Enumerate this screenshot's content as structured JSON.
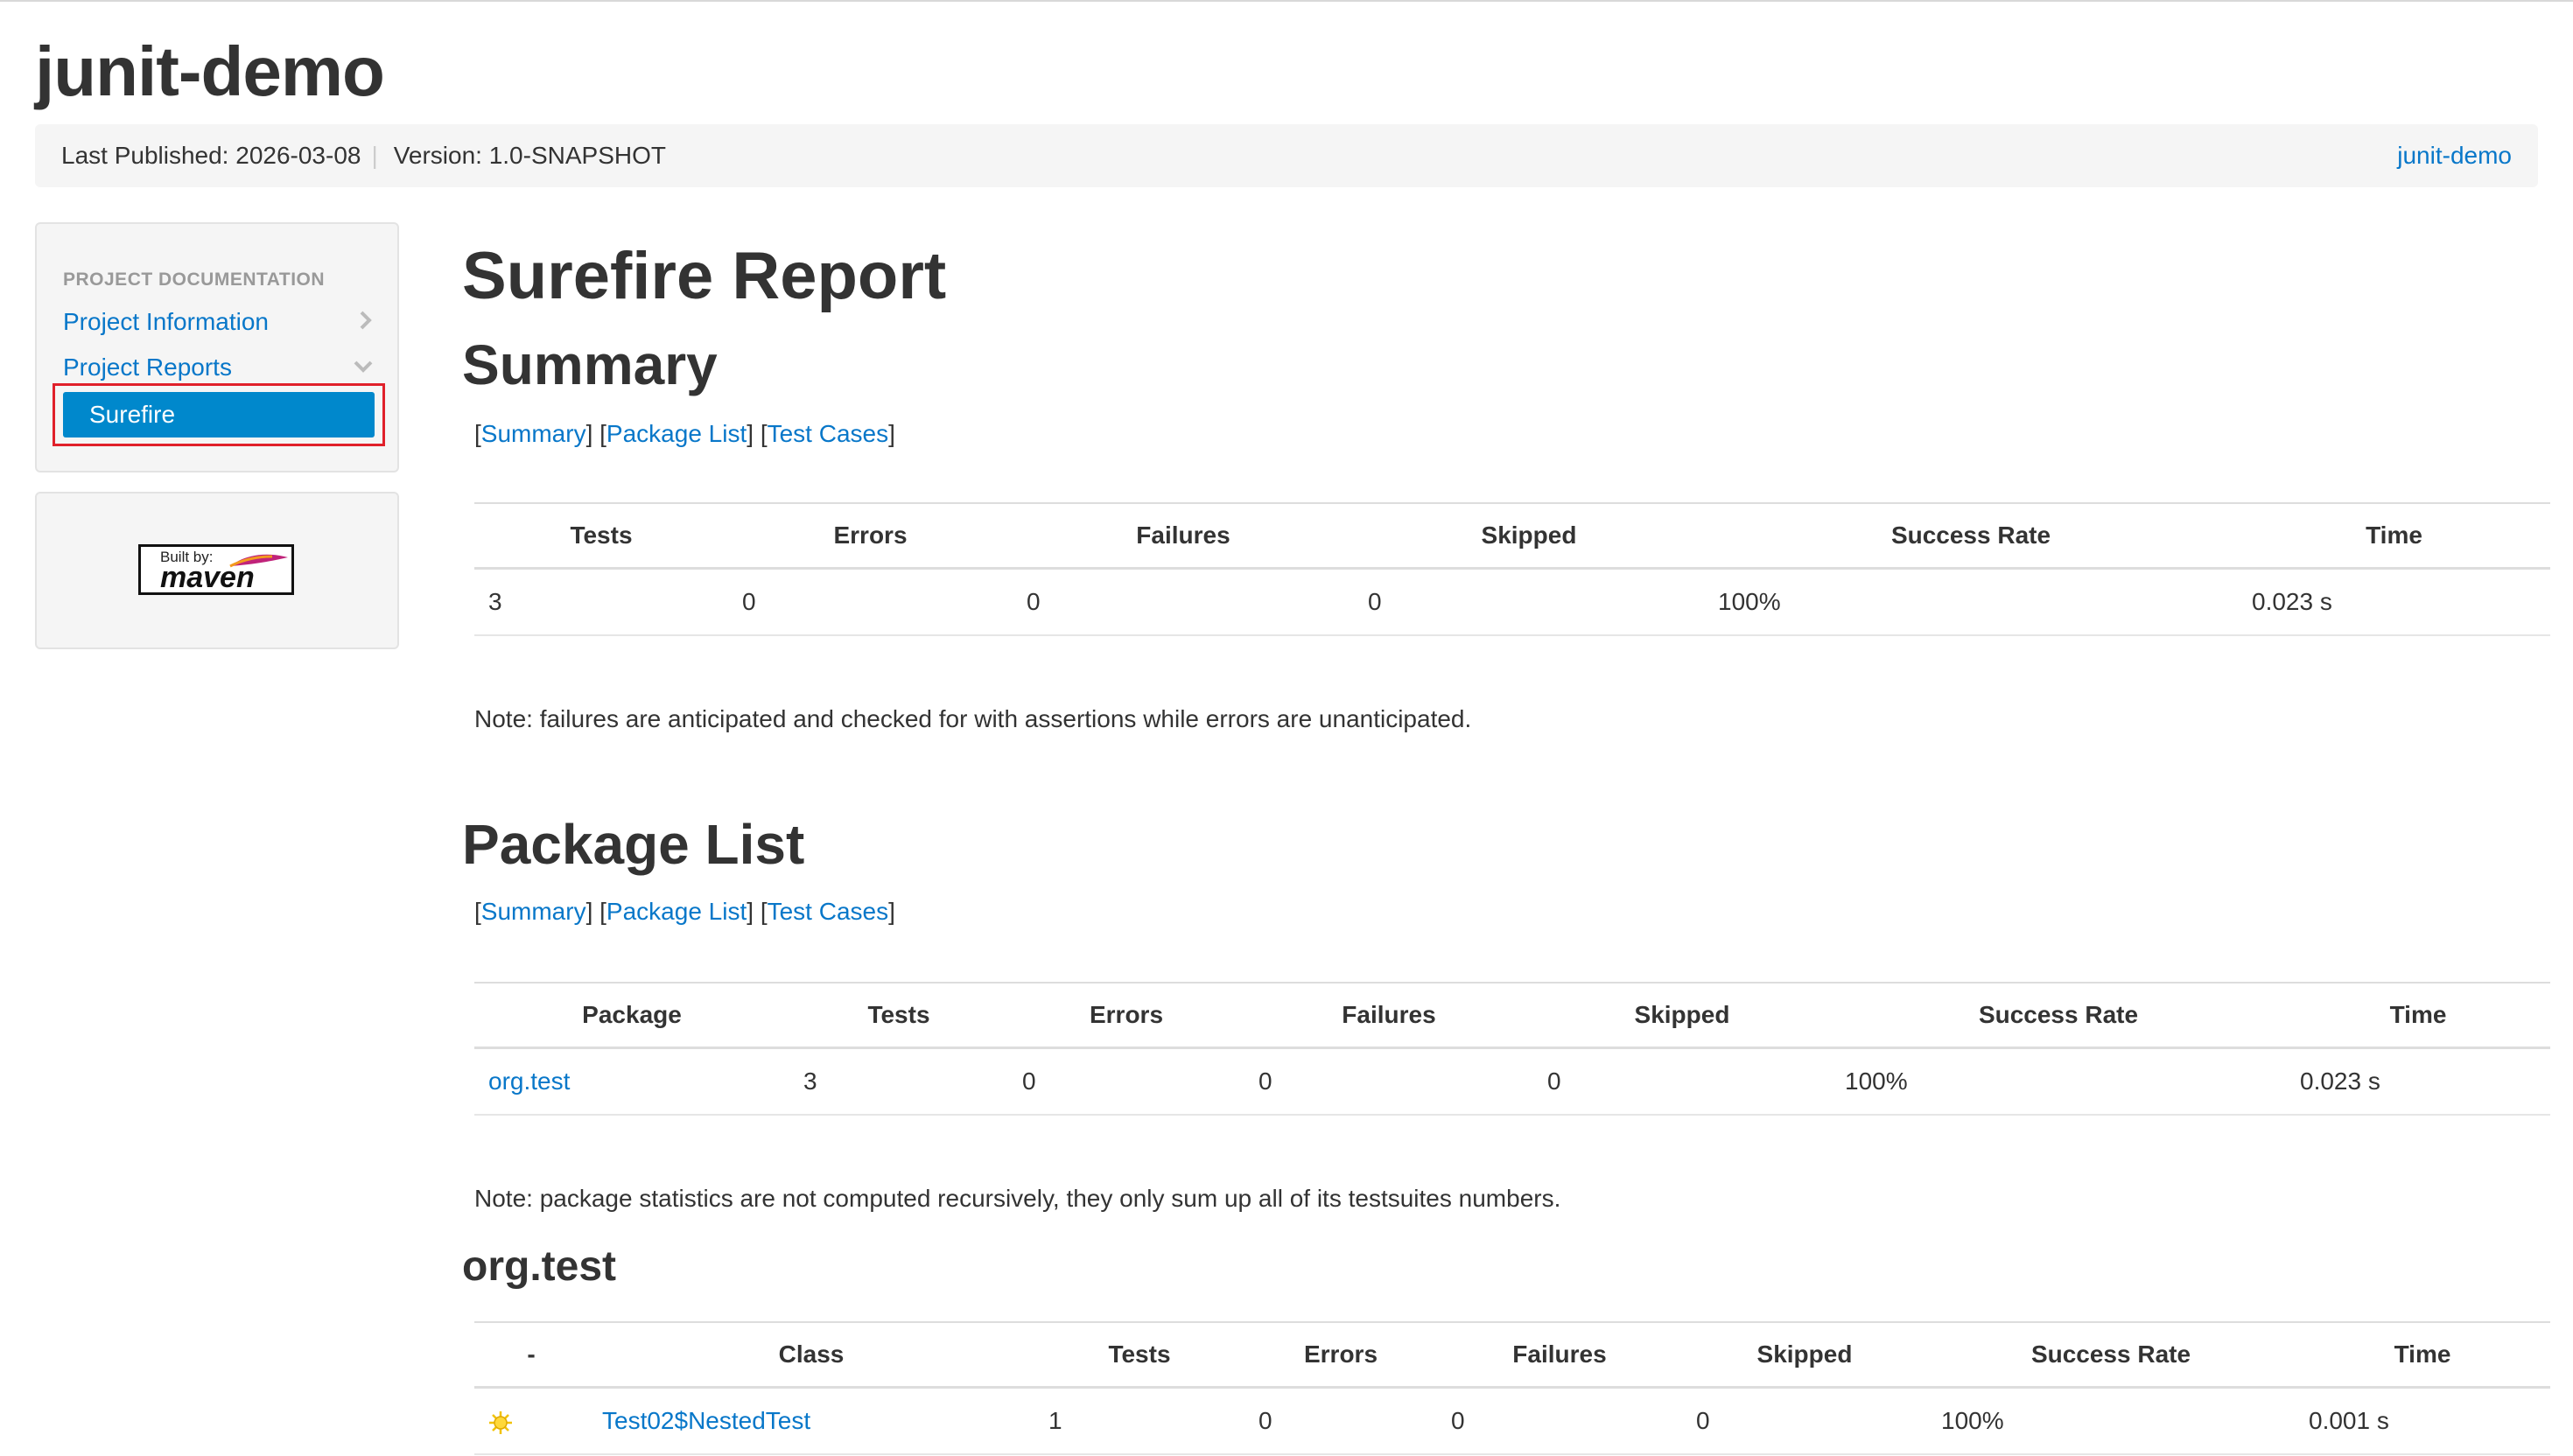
{
  "site": {
    "title": "junit-demo",
    "published": "Last Published: 2026-03-08",
    "version": "Version: 1.0-SNAPSHOT",
    "right_link": "junit-demo"
  },
  "sidebar": {
    "header": "PROJECT DOCUMENTATION",
    "items": [
      {
        "label": "Project Information",
        "icon": "chevron-right-icon"
      },
      {
        "label": "Project Reports",
        "icon": "chevron-down-icon"
      },
      {
        "label": "Surefire",
        "active": true
      }
    ],
    "badge": {
      "built": "Built by:",
      "name": "maven"
    }
  },
  "page": {
    "title": "Surefire Report"
  },
  "nav_links": {
    "open": "[",
    "close": "]",
    "summary": "Summary",
    "package_list": "Package List",
    "test_cases": "Test Cases"
  },
  "summary": {
    "heading": "Summary",
    "headers": [
      "Tests",
      "Errors",
      "Failures",
      "Skipped",
      "Success Rate",
      "Time"
    ],
    "row": [
      "3",
      "0",
      "0",
      "0",
      "100%",
      "0.023 s"
    ],
    "note": "Note: failures are anticipated and checked for with assertions while errors are unanticipated."
  },
  "package_list": {
    "heading": "Package List",
    "headers": [
      "Package",
      "Tests",
      "Errors",
      "Failures",
      "Skipped",
      "Success Rate",
      "Time"
    ],
    "row": [
      "org.test",
      "3",
      "0",
      "0",
      "0",
      "100%",
      "0.023 s"
    ],
    "note": "Note: package statistics are not computed recursively, they only sum up all of its testsuites numbers."
  },
  "package_detail": {
    "heading": "org.test",
    "headers": [
      "-",
      "Class",
      "Tests",
      "Errors",
      "Failures",
      "Skipped",
      "Success Rate",
      "Time"
    ],
    "row": {
      "icon": "success-icon",
      "cls": "Test02$NestedTest",
      "tests": "1",
      "errors": "0",
      "failures": "0",
      "skipped": "0",
      "rate": "100%",
      "time": "0.001 s"
    }
  },
  "colors": {
    "link": "#0877c9",
    "active_bg": "#0088cc",
    "highlight": "#e0202a"
  }
}
